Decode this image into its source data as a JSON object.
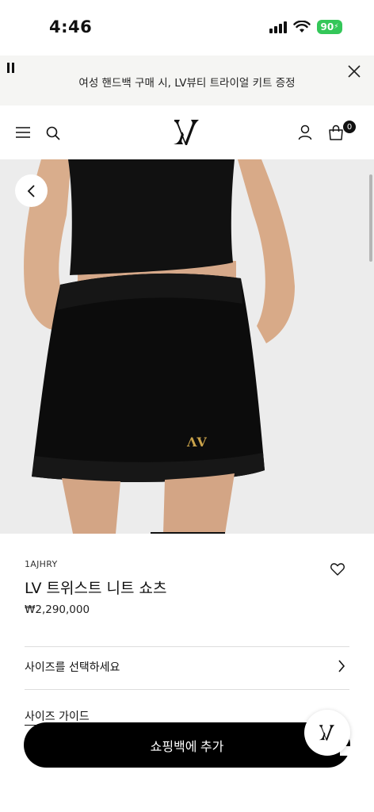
{
  "status_bar": {
    "time": "4:46",
    "battery": "90"
  },
  "promo": {
    "text": "여성 핸드백 구매 시, LV뷰티 트라이얼 키트 증정"
  },
  "header": {
    "cart_count": "0"
  },
  "product": {
    "sku": "1AJHRY",
    "name": "LV 트위스트 니트 쇼츠",
    "price": "₩2,290,000"
  },
  "size": {
    "select_label": "사이즈를 선택하세요",
    "guide_label": "사이즈 가이드"
  },
  "cta": {
    "add_to_bag": "쇼핑백에 추가"
  },
  "colors": {
    "accent": "#000000",
    "battery": "#34c759",
    "banner_bg": "#f5f5f3",
    "image_bg": "#ededed"
  }
}
